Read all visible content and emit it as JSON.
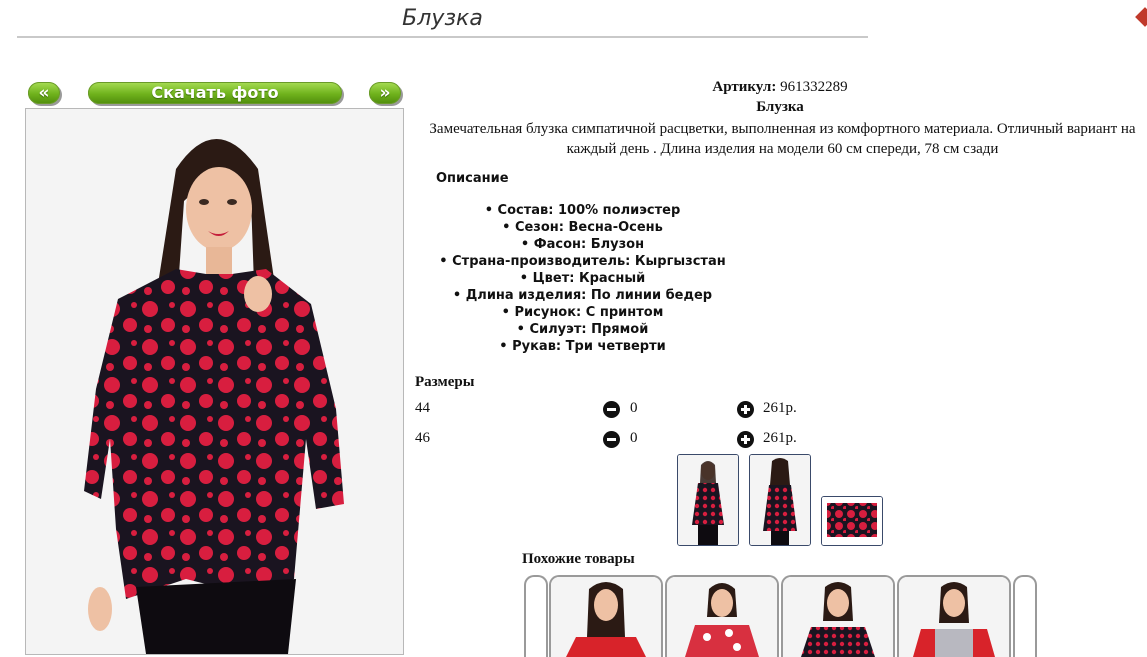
{
  "page": {
    "title": "Блузка"
  },
  "nav": {
    "prev_label": "«",
    "download_label": "Скачать фото",
    "next_label": "»"
  },
  "product": {
    "article_label": "Артикул:",
    "article_value": "961332289",
    "name": "Блузка",
    "description": "Замечательная блузка симпатичной расцветки, выполненная из комфортного материала. Отличный вариант на каждый день . Длина изделия на модели 60 см спереди, 78 см сзади",
    "description_heading": "Описание",
    "attributes": [
      "Состав: 100% полиэстер",
      "Сезон: Весна-Осень",
      "Фасон: Блузон",
      "Страна-производитель: Кыргызстан",
      "Цвет: Красный",
      "Длина изделия: По линии бедер",
      "Рисунок: С принтом",
      "Силуэт: Прямой",
      "Рукав: Три четверти"
    ]
  },
  "sizes": {
    "heading": "Размеры",
    "rows": [
      {
        "size": "44",
        "qty": "0",
        "price": "261р."
      },
      {
        "size": "46",
        "qty": "0",
        "price": "261р."
      }
    ]
  },
  "similar": {
    "heading": "Похожие товары"
  },
  "colors": {
    "accent_green": "#6fb21c",
    "print_red": "#d81e3f",
    "print_dark": "#1a1420"
  }
}
